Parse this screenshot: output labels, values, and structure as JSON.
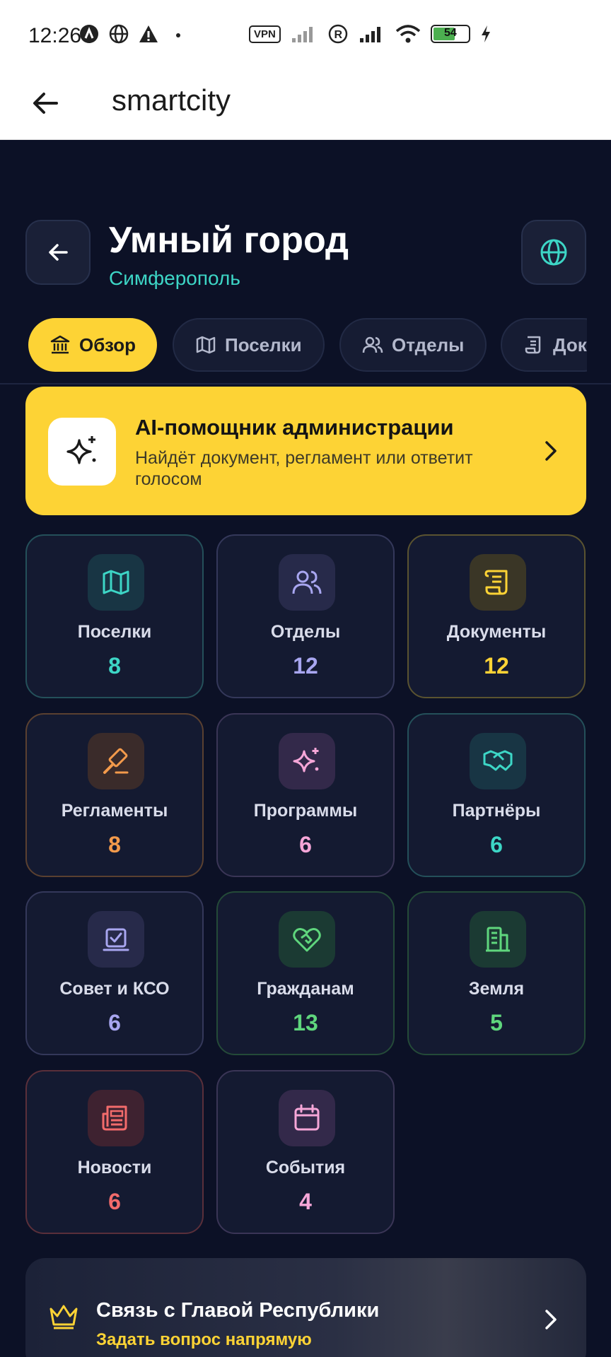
{
  "status_bar": {
    "time": "12:26",
    "vpn": "VPN",
    "battery": "54"
  },
  "app_bar": {
    "title": "smartcity"
  },
  "header": {
    "title": "Умный город",
    "subtitle": "Симферополь"
  },
  "tabs": [
    {
      "label": "Обзор",
      "icon": "bank-icon",
      "active": true
    },
    {
      "label": "Поселки",
      "icon": "map-icon",
      "active": false
    },
    {
      "label": "Отделы",
      "icon": "users-icon",
      "active": false
    },
    {
      "label": "Док",
      "icon": "scroll-icon",
      "active": false
    }
  ],
  "ai_card": {
    "title": "AI-помощник администрации",
    "description": "Найдёт документ, регламент или ответит голосом"
  },
  "tiles": [
    {
      "label": "Поселки",
      "count": "8",
      "icon": "map-icon",
      "accent": "#3dd6c6"
    },
    {
      "label": "Отделы",
      "count": "12",
      "icon": "users-icon",
      "accent": "#a8a6f0"
    },
    {
      "label": "Документы",
      "count": "12",
      "icon": "scroll-icon",
      "accent": "#fdd335"
    },
    {
      "label": "Регламенты",
      "count": "8",
      "icon": "gavel-icon",
      "accent": "#f39a4b"
    },
    {
      "label": "Программы",
      "count": "6",
      "icon": "sparkles-icon",
      "accent": "#f6a6d8"
    },
    {
      "label": "Партнёры",
      "count": "6",
      "icon": "handshake-icon",
      "accent": "#3dd6c6"
    },
    {
      "label": "Совет и КСО",
      "count": "6",
      "icon": "checklist-icon",
      "accent": "#a8a6f0"
    },
    {
      "label": "Гражданам",
      "count": "13",
      "icon": "heart-handshake-icon",
      "accent": "#5fd67d"
    },
    {
      "label": "Земля",
      "count": "5",
      "icon": "building-icon",
      "accent": "#5fd67d"
    },
    {
      "label": "Новости",
      "count": "6",
      "icon": "newspaper-icon",
      "accent": "#f26b6b"
    },
    {
      "label": "События",
      "count": "4",
      "icon": "calendar-icon",
      "accent": "#f6a6d8"
    }
  ],
  "banner": {
    "title": "Связь с Главой Республики",
    "subtitle": "Задать вопрос напрямую"
  }
}
